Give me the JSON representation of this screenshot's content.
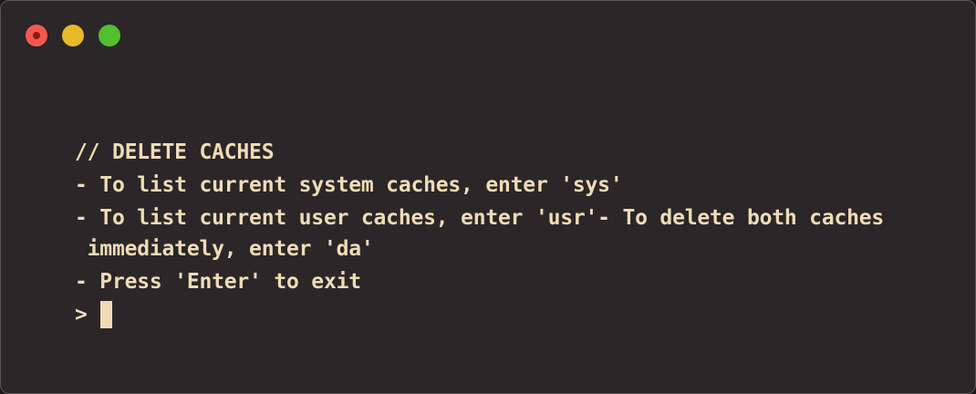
{
  "window": {
    "controls": {
      "close_color": "#f3584f",
      "minimize_color": "#e7ba2a",
      "maximize_color": "#52bf2c"
    }
  },
  "terminal": {
    "lines": [
      "// DELETE CACHES",
      "- To list current system caches, enter 'sys'",
      "- To list current user caches, enter 'usr'- To delete both caches",
      " immediately, enter 'da'",
      "- Press 'Enter' to exit"
    ],
    "prompt": ">"
  }
}
